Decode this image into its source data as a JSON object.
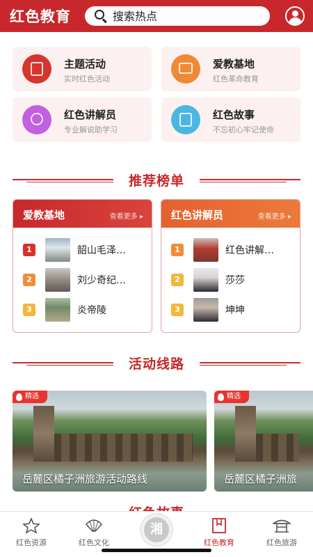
{
  "header": {
    "title": "红色教育",
    "search_placeholder": "搜索热点",
    "accent_color": "#c8282b"
  },
  "quick_cards": [
    {
      "title": "主题活动",
      "subtitle": "实时红色活动",
      "icon": "document-icon",
      "icon_color": "#d6342d"
    },
    {
      "title": "爱教基地",
      "subtitle": "红色革命教育",
      "icon": "monitor-icon",
      "icon_color": "#ee8a33"
    },
    {
      "title": "红色讲解员",
      "subtitle": "专业解说助学习",
      "icon": "microphone-icon",
      "icon_color": "#c160e0"
    },
    {
      "title": "红色故事",
      "subtitle": "不忘初心牢记使命",
      "icon": "book-icon",
      "icon_color": "#4ab7e0"
    }
  ],
  "ranking": {
    "title": "推荐榜单",
    "lists": [
      {
        "title": "爱教基地",
        "more": "查看更多",
        "color": "#c8282b",
        "items": [
          {
            "rank": "1",
            "name": "韶山毛泽…"
          },
          {
            "rank": "2",
            "name": "刘少奇纪…"
          },
          {
            "rank": "3",
            "name": "炎帝陵"
          }
        ]
      },
      {
        "title": "红色讲解员",
        "more": "查看更多",
        "color": "#e4612f",
        "items": [
          {
            "rank": "1",
            "name": "红色讲解…"
          },
          {
            "rank": "2",
            "name": "莎莎"
          },
          {
            "rank": "3",
            "name": "坤坤"
          }
        ]
      }
    ]
  },
  "routes": {
    "title": "活动线路",
    "items": [
      {
        "badge": "精选",
        "caption": "岳麓区橘子洲旅游活动路线"
      },
      {
        "badge": "精选",
        "caption": "岳麓区橘子洲旅"
      }
    ]
  },
  "next_section_title": "红色故事",
  "tabbar": {
    "center_label": "湘",
    "tabs": [
      {
        "label": "红色资源",
        "icon": "star-icon",
        "active": false
      },
      {
        "label": "红色文化",
        "icon": "fan-icon",
        "active": false
      },
      {
        "label": "红色教育",
        "icon": "bookmark-book-icon",
        "active": true
      },
      {
        "label": "红色旅游",
        "icon": "pavilion-icon",
        "active": false
      }
    ]
  }
}
